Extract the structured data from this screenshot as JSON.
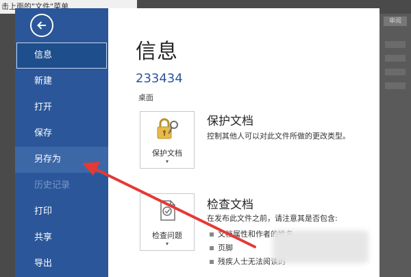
{
  "background_app": {
    "top_hint": "击上面的\"文件\"菜单",
    "right_tab": "审阅"
  },
  "sidebar": {
    "back_icon": "back-arrow-icon",
    "items": [
      {
        "label": "信息",
        "state": "active"
      },
      {
        "label": "新建",
        "state": "normal"
      },
      {
        "label": "打开",
        "state": "normal"
      },
      {
        "label": "保存",
        "state": "normal"
      },
      {
        "label": "另存为",
        "state": "hover"
      },
      {
        "label": "历史记录",
        "state": "disabled"
      },
      {
        "label": "打印",
        "state": "normal"
      },
      {
        "label": "共享",
        "state": "normal"
      },
      {
        "label": "导出",
        "state": "normal"
      }
    ]
  },
  "main": {
    "title": "信息",
    "document_name": "233434",
    "document_location": "桌面",
    "protect": {
      "tile_label": "保护文档",
      "icon": "lock-key-icon",
      "heading": "保护文档",
      "description": "控制其他人可以对此文件所做的更改类型。"
    },
    "inspect": {
      "tile_label": "检查问题",
      "icon": "document-check-icon",
      "heading": "检查文档",
      "description": "在发布此文件之前，请注意其是否包含:",
      "bullets": [
        "文档属性和作者的姓名",
        "页脚",
        "残疾人士无法阅读的"
      ]
    }
  },
  "annotation": {
    "arrow_color": "#e53935",
    "target": "另存为"
  }
}
